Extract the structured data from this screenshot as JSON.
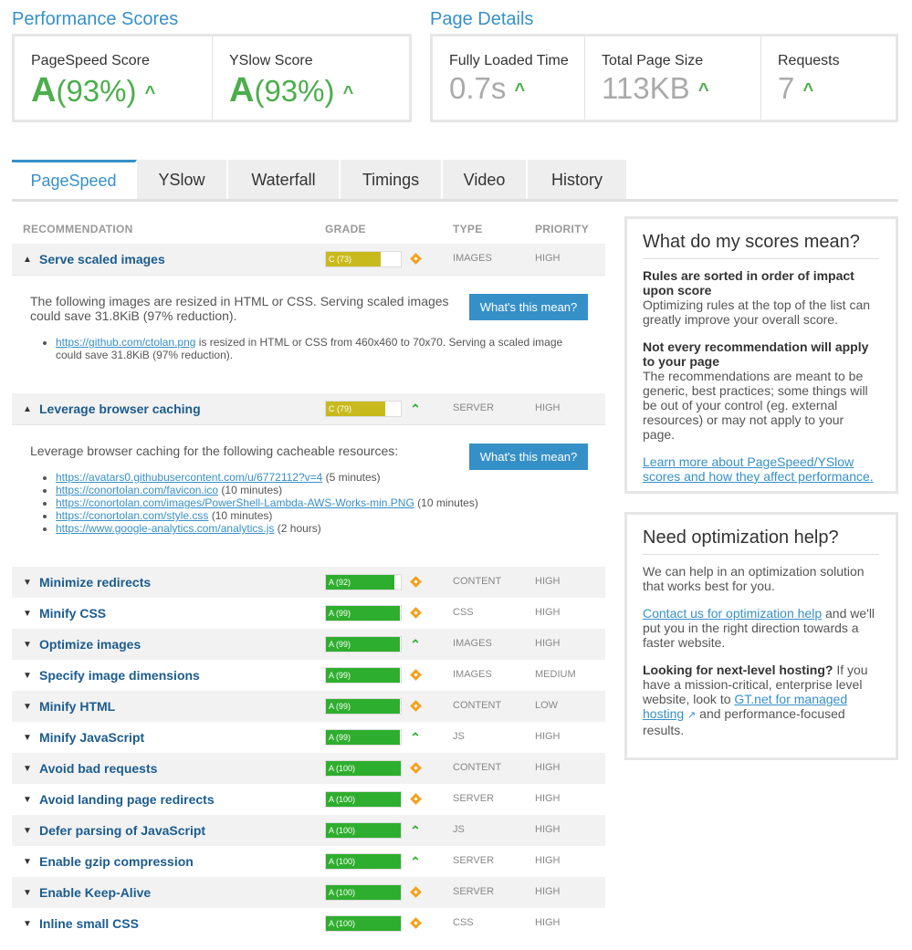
{
  "performance": {
    "title": "Performance Scores",
    "pagespeed": {
      "label": "PageSpeed Score",
      "grade": "A",
      "pct": "(93%)"
    },
    "yslow": {
      "label": "YSlow Score",
      "grade": "A",
      "pct": "(93%)"
    }
  },
  "details": {
    "title": "Page Details",
    "loaded": {
      "label": "Fully Loaded Time",
      "value": "0.7s"
    },
    "size": {
      "label": "Total Page Size",
      "value": "113KB"
    },
    "requests": {
      "label": "Requests",
      "value": "7"
    }
  },
  "tabs": [
    "PageSpeed",
    "YSlow",
    "Waterfall",
    "Timings",
    "Video",
    "History"
  ],
  "table_headers": {
    "recommendation": "RECOMMENDATION",
    "grade": "GRADE",
    "type": "TYPE",
    "priority": "PRIORITY"
  },
  "rows": [
    {
      "name": "Serve scaled images",
      "grade": "C (73)",
      "score": 73,
      "cls": "c",
      "indicator": "diamond",
      "type": "IMAGES",
      "priority": "HIGH",
      "expanded": true
    },
    {
      "name": "Leverage browser caching",
      "grade": "C (79)",
      "score": 79,
      "cls": "c",
      "indicator": "chevron",
      "type": "SERVER",
      "priority": "HIGH",
      "expanded": true
    },
    {
      "name": "Minimize redirects",
      "grade": "A (92)",
      "score": 92,
      "cls": "a",
      "indicator": "diamond",
      "type": "CONTENT",
      "priority": "HIGH"
    },
    {
      "name": "Minify CSS",
      "grade": "A (99)",
      "score": 99,
      "cls": "a",
      "indicator": "diamond",
      "type": "CSS",
      "priority": "HIGH"
    },
    {
      "name": "Optimize images",
      "grade": "A (99)",
      "score": 99,
      "cls": "a",
      "indicator": "chevron",
      "type": "IMAGES",
      "priority": "HIGH"
    },
    {
      "name": "Specify image dimensions",
      "grade": "A (99)",
      "score": 99,
      "cls": "a",
      "indicator": "diamond",
      "type": "IMAGES",
      "priority": "MEDIUM"
    },
    {
      "name": "Minify HTML",
      "grade": "A (99)",
      "score": 99,
      "cls": "a",
      "indicator": "diamond",
      "type": "CONTENT",
      "priority": "LOW"
    },
    {
      "name": "Minify JavaScript",
      "grade": "A (99)",
      "score": 99,
      "cls": "a",
      "indicator": "chevron",
      "type": "JS",
      "priority": "HIGH"
    },
    {
      "name": "Avoid bad requests",
      "grade": "A (100)",
      "score": 100,
      "cls": "a",
      "indicator": "diamond",
      "type": "CONTENT",
      "priority": "HIGH"
    },
    {
      "name": "Avoid landing page redirects",
      "grade": "A (100)",
      "score": 100,
      "cls": "a",
      "indicator": "diamond",
      "type": "SERVER",
      "priority": "HIGH"
    },
    {
      "name": "Defer parsing of JavaScript",
      "grade": "A (100)",
      "score": 100,
      "cls": "a",
      "indicator": "chevron",
      "type": "JS",
      "priority": "HIGH"
    },
    {
      "name": "Enable gzip compression",
      "grade": "A (100)",
      "score": 100,
      "cls": "a",
      "indicator": "chevron",
      "type": "SERVER",
      "priority": "HIGH"
    },
    {
      "name": "Enable Keep-Alive",
      "grade": "A (100)",
      "score": 100,
      "cls": "a",
      "indicator": "diamond",
      "type": "SERVER",
      "priority": "HIGH"
    },
    {
      "name": "Inline small CSS",
      "grade": "A (100)",
      "score": 100,
      "cls": "a",
      "indicator": "diamond",
      "type": "CSS",
      "priority": "HIGH"
    }
  ],
  "detail1": {
    "desc": "The following images are resized in HTML or CSS. Serving scaled images could save 31.8KiB (97% reduction).",
    "button": "What's this mean?",
    "link": "https://github.com/ctolan.png",
    "link_text": " is resized in HTML or CSS from 460x460 to 70x70. Serving a scaled image could save 31.8KiB (97% reduction)."
  },
  "detail2": {
    "desc": "Leverage browser caching for the following cacheable resources:",
    "button": "What's this mean?",
    "items": [
      {
        "url": "https://avatars0.githubusercontent.com/u/6772112?v=4",
        "note": " (5 minutes)"
      },
      {
        "url": "https://conortolan.com/favicon.ico",
        "note": " (10 minutes)"
      },
      {
        "url": "https://conortolan.com/images/PowerShell-Lambda-AWS-Works-min.PNG",
        "note": " (10 minutes)"
      },
      {
        "url": "https://conortolan.com/style.css",
        "note": " (10 minutes)"
      },
      {
        "url": "https://www.google-analytics.com/analytics.js",
        "note": " (2 hours)"
      }
    ]
  },
  "side1": {
    "title": "What do my scores mean?",
    "p1_bold": "Rules are sorted in order of impact upon score",
    "p1": "Optimizing rules at the top of the list can greatly improve your overall score.",
    "p2_bold": "Not every recommendation will apply to your page",
    "p2": "The recommendations are meant to be generic, best practices; some things will be out of your control (eg. external resources) or may not apply to your page.",
    "link": "Learn more about PageSpeed/YSlow scores and how they affect performance."
  },
  "side2": {
    "title": "Need optimization help?",
    "p1": "We can help in an optimization solution that works best for you.",
    "p2_link": "Contact us for optimization help",
    "p2": " and we'll put you in the right direction towards a faster website.",
    "p3_bold": "Looking for next-level hosting?",
    "p3": " If you have a mission-critical, enterprise level website, look to ",
    "p3_link": "GT.net for managed hosting",
    "p3_end": " and performance-focused results."
  }
}
